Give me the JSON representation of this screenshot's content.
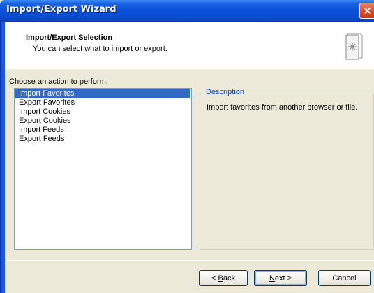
{
  "window": {
    "title": "Import/Export Wizard",
    "close_label": "×"
  },
  "header": {
    "title": "Import/Export Selection",
    "subtitle": "You can select what to import or export.",
    "icon": "document-star-icon"
  },
  "main": {
    "prompt": "Choose an action to perform.",
    "actions": [
      {
        "label": "Import Favorites",
        "selected": true
      },
      {
        "label": "Export Favorites",
        "selected": false
      },
      {
        "label": "Import Cookies",
        "selected": false
      },
      {
        "label": "Export Cookies",
        "selected": false
      },
      {
        "label": "Import Feeds",
        "selected": false
      },
      {
        "label": "Export Feeds",
        "selected": false
      }
    ],
    "description": {
      "legend": "Description",
      "text": "Import favorites from another browser or file."
    }
  },
  "buttons": {
    "back": {
      "pre": "< ",
      "mnemonic": "B",
      "post": "ack"
    },
    "next": {
      "mnemonic": "N",
      "post": "ext >"
    },
    "cancel": "Cancel"
  },
  "colors": {
    "titlebar": "#0a4bd0",
    "selection": "#316ac5",
    "group_legend": "#0046d5",
    "dialog_bg": "#ece9d8"
  }
}
